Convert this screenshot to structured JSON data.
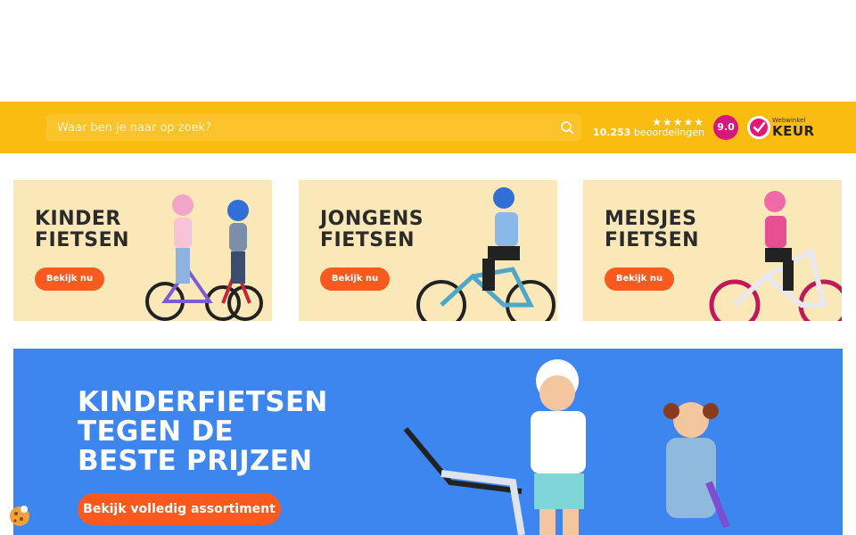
{
  "search": {
    "placeholder": "Waar ben je naar op zoek?"
  },
  "rating": {
    "stars": "★★★★★",
    "review_count": "10.253",
    "review_label": "beoordelingen",
    "score": "9.0"
  },
  "webwinkelkeur": {
    "small": "Webwinkel",
    "big": "KEUR"
  },
  "categories": [
    {
      "title": "KINDER\nFIETSEN",
      "button": "Bekijk nu"
    },
    {
      "title": "JONGENS\nFIETSEN",
      "button": "Bekijk nu"
    },
    {
      "title": "MEISJES\nFIETSEN",
      "button": "Bekijk nu"
    }
  ],
  "hero": {
    "title": "KINDERFIETSEN\nTEGEN DE\nBESTE PRIJZEN",
    "button": "Bekijk volledig assortiment"
  },
  "colors": {
    "accent_yellow": "#fbbc12",
    "cta_orange": "#fb5a1e",
    "hero_blue": "#3d86f0",
    "category_bg": "#fbe8b9",
    "score_pink": "#d6187c"
  }
}
